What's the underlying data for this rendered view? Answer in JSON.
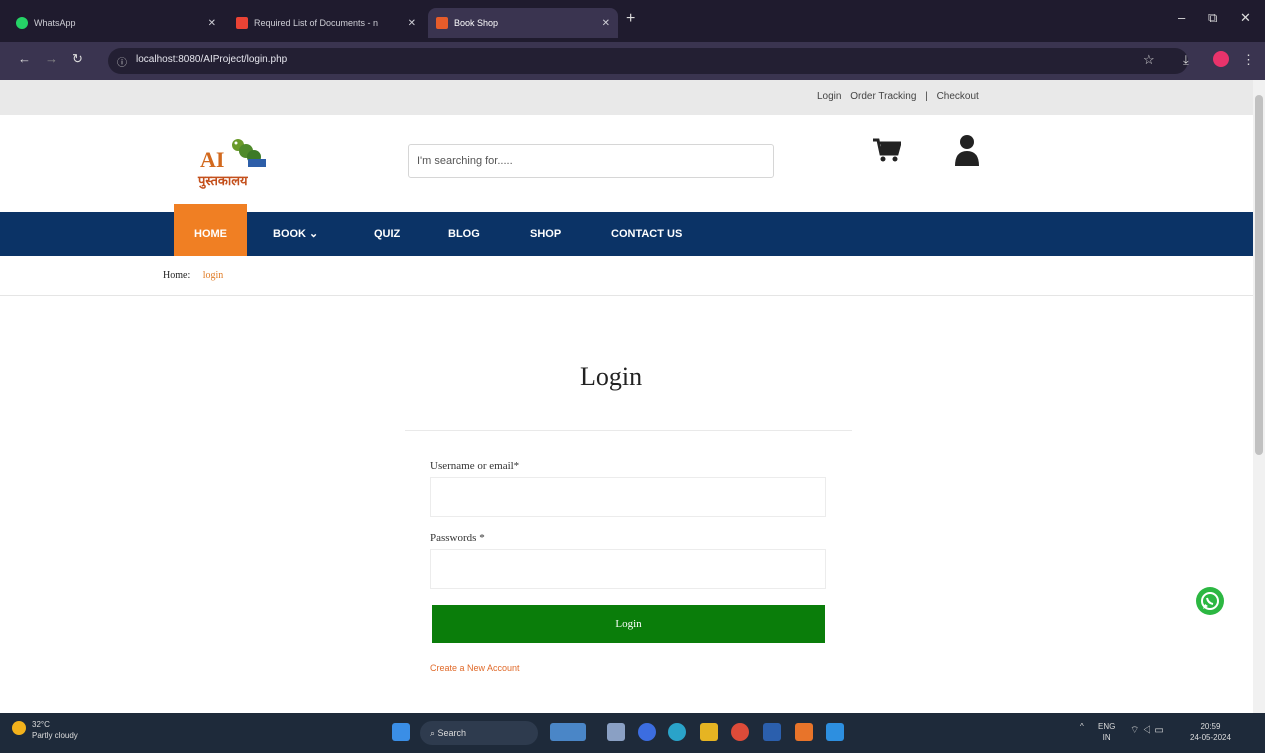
{
  "browser": {
    "tabs": [
      {
        "label": "WhatsApp",
        "favicon_color": "#25d366"
      },
      {
        "label": "Required List of Documents - n",
        "favicon_color": "#ea4335"
      },
      {
        "label": "Book Shop",
        "favicon_color": "#e65c2a"
      }
    ],
    "url": "localhost:8080/AIProject/login.php",
    "new_tab": "+",
    "window_controls": [
      "–",
      "⧉",
      "✕"
    ]
  },
  "header": {
    "top_links": [
      "Login",
      "Order Tracking",
      "|",
      "Checkout"
    ],
    "logo": {
      "ai": "AI",
      "hindi": "पुस्तकालय"
    },
    "search_placeholder": "I'm searching for.....",
    "icons": {
      "cart": "cart-icon",
      "user": "user-icon"
    }
  },
  "nav": {
    "items": [
      "HOME",
      "BOOK ⌄",
      "QUIZ",
      "BLOG",
      "SHOP",
      "CONTACT US"
    ],
    "active": "HOME"
  },
  "breadcrumb": {
    "home": "Home",
    "current": "login"
  },
  "login": {
    "title": "Login",
    "username_label": "Username or email*",
    "password_label": "Passwords *",
    "button": "Login",
    "create_account": "Create a New Account"
  },
  "taskbar": {
    "weather_temp": "32°C",
    "weather_desc": "Partly cloudy",
    "search_label": "Search",
    "lang": "ENG\nIN",
    "time": "20:59",
    "date": "24-05-2024"
  },
  "colors": {
    "nav_bg": "#0b3366",
    "accent_orange": "#f07f23",
    "login_green": "#0a7d0a"
  }
}
